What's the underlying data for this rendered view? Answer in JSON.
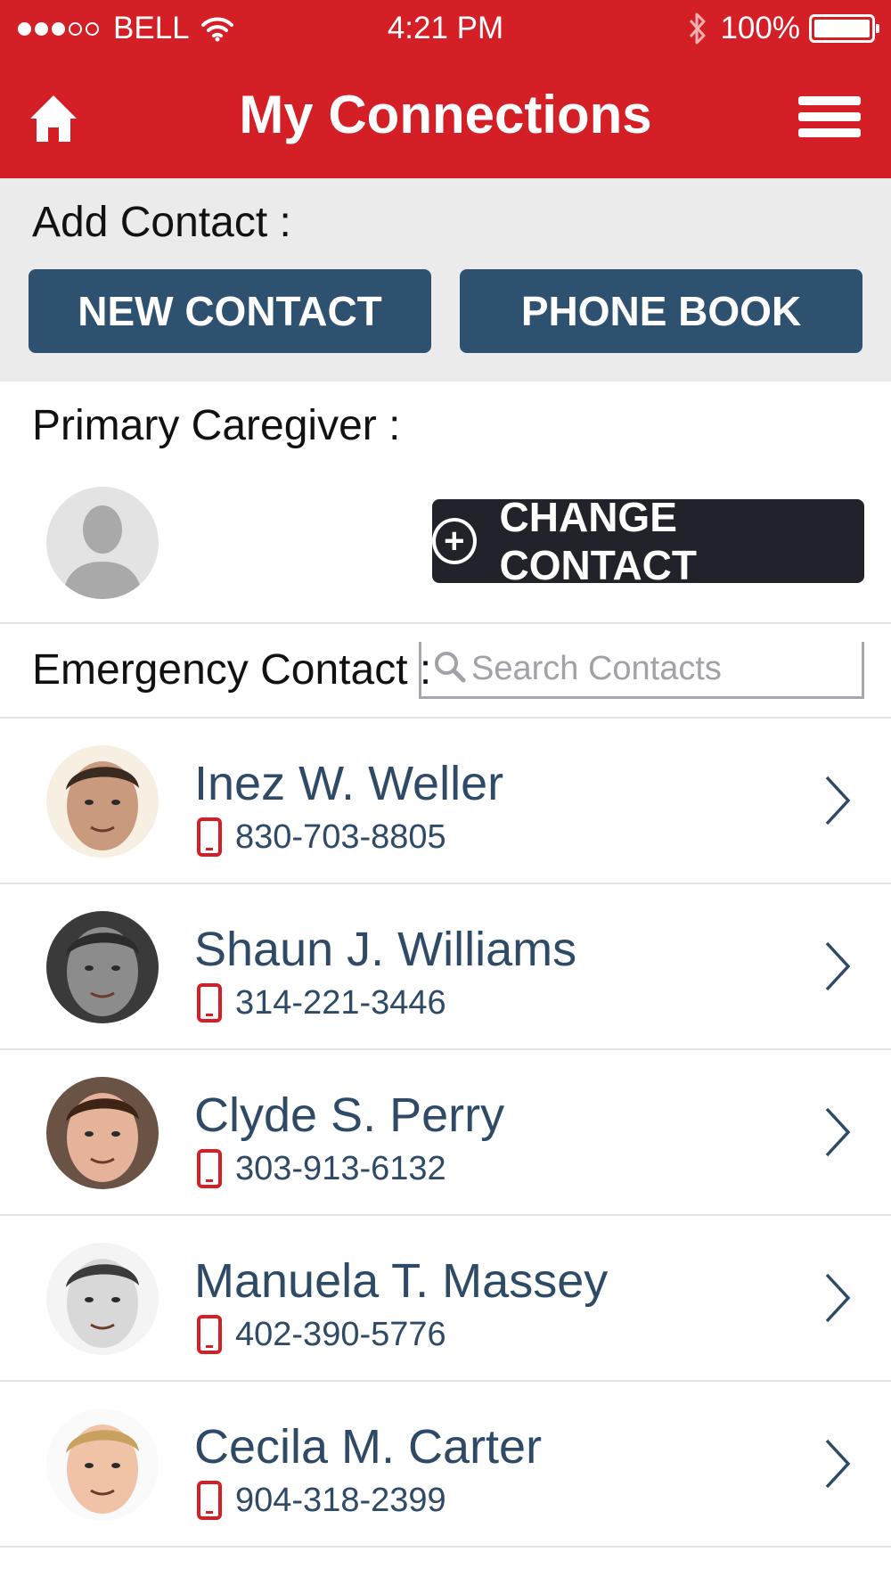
{
  "status_bar": {
    "carrier": "BELL",
    "time": "4:21 PM",
    "battery": "100%",
    "signal_bars_filled": 3,
    "signal_bars_total": 5,
    "battery_level": 1.0
  },
  "header": {
    "title": "My Connections",
    "home_icon": "home-icon",
    "menu_icon": "hamburger-menu-icon",
    "background": "#d41f26"
  },
  "add_contact": {
    "label": "Add Contact :",
    "new_contact_label": "NEW CONTACT",
    "phone_book_label": "PHONE BOOK",
    "button_color": "#2e5170"
  },
  "primary_caregiver": {
    "label": "Primary Caregiver :",
    "change_contact_label": "CHANGE CONTACT",
    "avatar_icon": "person-placeholder-icon"
  },
  "emergency_contact": {
    "label": "Emergency Contact :",
    "search_placeholder": "Search Contacts",
    "search_value": ""
  },
  "contacts": [
    {
      "name": "Inez W. Weller",
      "phone": "830-703-8805"
    },
    {
      "name": "Shaun J. Williams",
      "phone": "314-221-3446"
    },
    {
      "name": "Clyde S. Perry",
      "phone": "303-913-6132"
    },
    {
      "name": "Manuela T. Massey",
      "phone": "402-390-5776"
    },
    {
      "name": "Cecila M. Carter",
      "phone": "904-318-2399"
    }
  ],
  "colors": {
    "accent_red": "#d41f26",
    "name_text": "#2e4a66",
    "dark_button": "#22232a"
  }
}
